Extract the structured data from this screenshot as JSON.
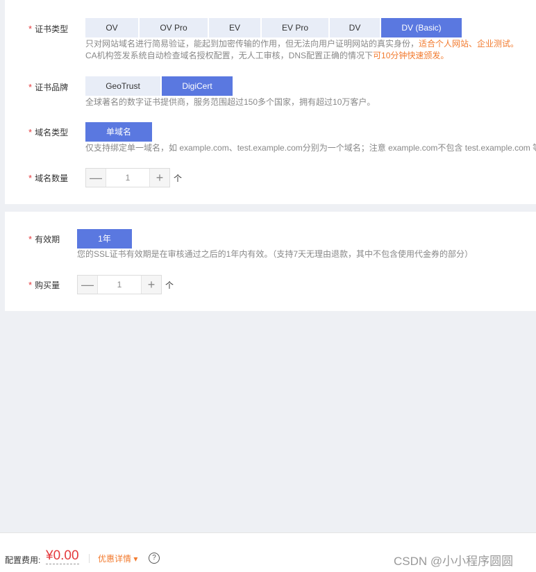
{
  "cert_type": {
    "label": "证书类型",
    "options": [
      "OV",
      "OV Pro",
      "EV",
      "EV Pro",
      "DV",
      "DV (Basic)"
    ],
    "hint_line1_a": "只对网站域名进行简易验证，能起到加密传输的作用，但无法向用户证明网站的真实身份，",
    "hint_line1_b": "适合个人网站、企业测试。",
    "hint_line2_a": "CA机构签发系统自动检查域名授权配置，无人工审核，DNS配置正确的情况下",
    "hint_line2_b": "可10分钟快速颁发。"
  },
  "cert_brand": {
    "label": "证书品牌",
    "options": [
      "GeoTrust",
      "DigiCert"
    ],
    "hint": "全球著名的数字证书提供商，服务范围超过150多个国家，拥有超过10万客户。"
  },
  "domain_type": {
    "label": "域名类型",
    "option": "单域名",
    "hint": "仅支持绑定单一域名，如 example.com、test.example.com分别为一个域名；注意 example.com不包含 test.example.com 等"
  },
  "domain_count": {
    "label": "域名数量",
    "minus": "—",
    "value": "1",
    "plus": "+",
    "unit": "个"
  },
  "validity": {
    "label": "有效期",
    "option": "1年",
    "hint": "您的SSL证书有效期是在审核通过之后的1年内有效。（支持7天无理由退款，其中不包含使用代金券的部分）"
  },
  "quantity": {
    "label": "购买量",
    "minus": "—",
    "value": "1",
    "plus": "+",
    "unit": "个"
  },
  "footer": {
    "fee_label": "配置费用:",
    "price": "¥0.00",
    "discount": "优惠详情 ▾",
    "help": "?",
    "watermark": "CSDN @小小程序圆圆"
  },
  "colors": {
    "accent": "#5a78e0",
    "option_bg": "#e8edf7",
    "required": "#e4393c",
    "highlight": "#f27a2e"
  }
}
